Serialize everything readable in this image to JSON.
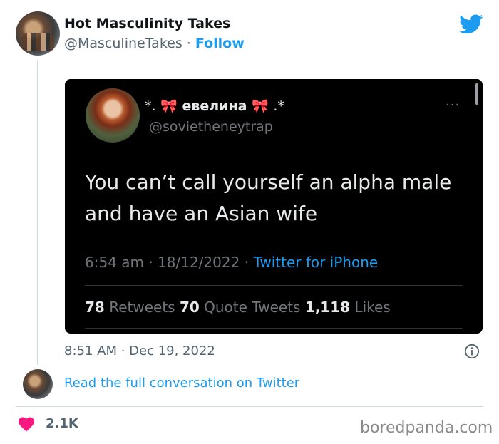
{
  "tweet": {
    "account_name": "Hot Masculinity Takes",
    "handle": "@MasculineTakes",
    "separator": "·",
    "follow_label": "Follow",
    "timestamp": "8:51 AM · Dec 19, 2022",
    "read_link": "Read the full conversation on Twitter",
    "like_count": "2.1K"
  },
  "embedded": {
    "name_prefix": "*.",
    "bow1": "🎀",
    "name": "евелина",
    "bow2": "🎀",
    "name_suffix": ".*",
    "handle": "@sovietheneytrap",
    "more": "···",
    "text": "You can’t call yourself an alpha male and have an Asian wife",
    "meta_time": "6:54 am · 18/12/2022 · ",
    "meta_source": "Twitter for iPhone",
    "retweets_count": "78",
    "retweets_label": "Retweets",
    "quotes_count": "70",
    "quotes_label": "Quote Tweets",
    "likes_count": "1,118",
    "likes_label": "Likes"
  },
  "watermark": "boredpanda.com",
  "colors": {
    "accent": "#1d9bf0",
    "heart": "#f91880",
    "embed_bg": "#000000"
  },
  "icons": [
    "twitter-bird-icon",
    "info-icon",
    "heart-icon"
  ]
}
